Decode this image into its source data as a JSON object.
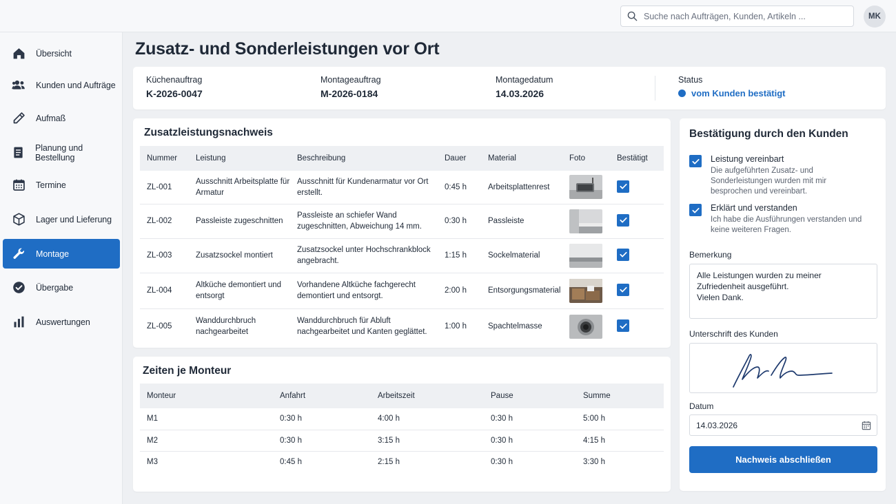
{
  "header": {
    "search_placeholder": "Suche nach Aufträgen, Kunden, Artikeln ...",
    "user_initials": "MK"
  },
  "sidebar": {
    "items": [
      {
        "label": "Übersicht",
        "icon": "home-icon",
        "active": false
      },
      {
        "label": "Kunden und Aufträge",
        "icon": "users-icon",
        "active": false
      },
      {
        "label": "Aufmaß",
        "icon": "pencil-icon",
        "active": false
      },
      {
        "label": "Planung und Bestellung",
        "icon": "document-icon",
        "active": false
      },
      {
        "label": "Termine",
        "icon": "calendar-icon",
        "active": false
      },
      {
        "label": "Lager und Lieferung",
        "icon": "box-icon",
        "active": false
      },
      {
        "label": "Montage",
        "icon": "wrench-icon",
        "active": true
      },
      {
        "label": "Übergabe",
        "icon": "check-circle-icon",
        "active": false
      },
      {
        "label": "Auswertungen",
        "icon": "bar-chart-icon",
        "active": false
      }
    ]
  },
  "page": {
    "title": "Zusatz- und Sonderleistungen vor Ort"
  },
  "info": {
    "kitchen_order_label": "Küchenauftrag",
    "kitchen_order_value": "K-2026-0047",
    "assembly_order_label": "Montageauftrag",
    "assembly_order_value": "M-2026-0184",
    "assembly_date_label": "Montagedatum",
    "assembly_date_value": "14.03.2026",
    "status_label": "Status",
    "status_value": "vom Kunden bestätigt"
  },
  "services": {
    "title": "Zusatzleistungsnachweis",
    "columns": [
      "Nummer",
      "Leistung",
      "Beschreibung",
      "Dauer",
      "Material",
      "Foto",
      "Bestätigt"
    ],
    "rows": [
      {
        "number": "ZL-001",
        "service": "Ausschnitt Arbeitsplatte für Armatur",
        "description": "Ausschnitt für Kundenarmatur vor Ort erstellt.",
        "duration": "0:45 h",
        "material": "Arbeitsplattenrest",
        "photo": "sink-photo",
        "confirmed": true
      },
      {
        "number": "ZL-002",
        "service": "Passleiste zugeschnitten",
        "description": "Passleiste an schiefer Wand zugeschnitten, Abweichung 14 mm.",
        "duration": "0:30 h",
        "material": "Passleiste",
        "photo": "strip-photo",
        "confirmed": true
      },
      {
        "number": "ZL-003",
        "service": "Zusatzsockel montiert",
        "description": "Zusatzsockel unter Hochschrankblock angebracht.",
        "duration": "1:15 h",
        "material": "Sockelmaterial",
        "photo": "plinth-photo",
        "confirmed": true
      },
      {
        "number": "ZL-004",
        "service": "Altküche demontiert und entsorgt",
        "description": "Vorhandene Altküche fachgerecht demontiert und entsorgt.",
        "duration": "2:00 h",
        "material": "Entsorgungsmaterial",
        "photo": "old-kitchen-photo",
        "confirmed": true
      },
      {
        "number": "ZL-005",
        "service": "Wanddurchbruch nachgearbeitet",
        "description": "Wanddurchbruch für Abluft nachgearbeitet und Kanten geglättet.",
        "duration": "1:00 h",
        "material": "Spachtelmasse",
        "photo": "wall-hole-photo",
        "confirmed": true
      }
    ]
  },
  "times": {
    "title": "Zeiten je Monteur",
    "columns": [
      "Monteur",
      "Anfahrt",
      "Arbeitszeit",
      "Pause",
      "Summe"
    ],
    "rows": [
      {
        "fitter": "M1",
        "travel": "0:30 h",
        "work": "4:00 h",
        "pause": "0:30 h",
        "sum": "5:00 h"
      },
      {
        "fitter": "M2",
        "travel": "0:30 h",
        "work": "3:15 h",
        "pause": "0:30 h",
        "sum": "4:15 h"
      },
      {
        "fitter": "M3",
        "travel": "0:45 h",
        "work": "2:15 h",
        "pause": "0:30 h",
        "sum": "3:30 h"
      }
    ]
  },
  "confirmation": {
    "title": "Bestätigung durch den Kunden",
    "check1_title": "Leistung vereinbart",
    "check1_desc": "Die aufgeführten Zusatz- und Sonderleistungen wurden mit mir besprochen und vereinbart.",
    "check2_title": "Erklärt und verstanden",
    "check2_desc": "Ich habe die Ausführungen verstanden und keine weiteren Fragen.",
    "remark_label": "Bemerkung",
    "remark_line1": "Alle Leistungen wurden zu meiner",
    "remark_line2": "Zufriedenheit ausgeführt.",
    "remark_line3": "Vielen Dank.",
    "signature_label": "Unterschrift des Kunden",
    "date_label": "Datum",
    "date_value": "14.03.2026",
    "submit_label": "Nachweis abschließen"
  },
  "colors": {
    "accent": "#1f6dc4",
    "background": "#eef0f3"
  }
}
